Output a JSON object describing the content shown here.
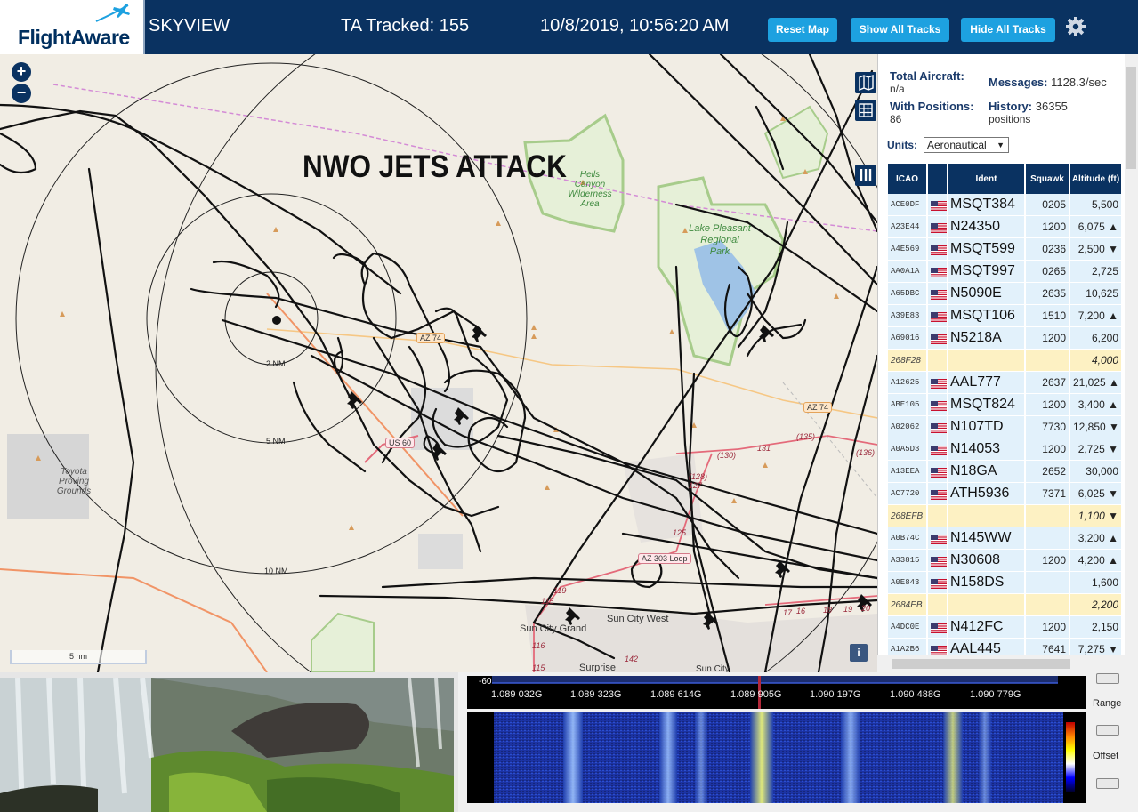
{
  "header": {
    "logo_text": "FlightAware",
    "site_name": "SKYVIEW",
    "tracked": "TA Tracked: 155",
    "datetime": "10/8/2019, 10:56:20 AM",
    "buttons": {
      "reset": "Reset Map",
      "show_all": "Show All Tracks",
      "hide_all": "Hide All Tracks"
    }
  },
  "map": {
    "overlay_title": "NWO JETS ATTACK",
    "zoom_in": "+",
    "zoom_out": "−",
    "range_labels": [
      "2 NM",
      "5 NM",
      "10 NM"
    ],
    "park_labels": [
      "Hells Canyon",
      "Wilderness",
      "Area",
      "Lake Pleasant",
      "Regional",
      "Park",
      "Toyota",
      "Proving",
      "Grounds"
    ],
    "city_labels": [
      "Sun City West",
      "Sun City Grand",
      "Surprise",
      "Sun City"
    ],
    "road_badges": [
      "US 60",
      "AZ 74",
      "AZ 74",
      "AZ 303 Loop"
    ],
    "route_numbers": [
      "(135)",
      "131",
      "(130)",
      "(128)",
      "127",
      "125",
      "(136)",
      "119",
      "115",
      "116",
      "115",
      "142",
      "17",
      "16",
      "18",
      "19",
      "20"
    ],
    "scale": "5 nm",
    "info_button": "i"
  },
  "stats": {
    "total_aircraft_label": "Total Aircraft:",
    "total_aircraft_value": "n/a",
    "with_positions_label": "With Positions:",
    "with_positions_value": "86",
    "messages_label": "Messages:",
    "messages_value": "1128.3/sec",
    "history_label": "History:",
    "history_value": "36355",
    "history_unit": "positions"
  },
  "units": {
    "label": "Units:",
    "selected": "Aeronautical"
  },
  "table": {
    "headers": [
      "ICAO",
      "Ident",
      "Squawk",
      "Altitude (ft)"
    ],
    "rows": [
      {
        "icao": "ACE0DF",
        "flag": true,
        "ident": "MSQT384",
        "squawk": "0205",
        "alt": "5,500"
      },
      {
        "icao": "A23E44",
        "flag": true,
        "ident": "N24350",
        "squawk": "1200",
        "alt": "6,075 ▲"
      },
      {
        "icao": "A4E569",
        "flag": true,
        "ident": "MSQT599",
        "squawk": "0236",
        "alt": "2,500 ▼"
      },
      {
        "icao": "AA0A1A",
        "flag": true,
        "ident": "MSQT997",
        "squawk": "0265",
        "alt": "2,725"
      },
      {
        "icao": "A65DBC",
        "flag": true,
        "ident": "N5090E",
        "squawk": "2635",
        "alt": "10,625"
      },
      {
        "icao": "A39E83",
        "flag": true,
        "ident": "MSQT106",
        "squawk": "1510",
        "alt": "7,200 ▲"
      },
      {
        "icao": "A69016",
        "flag": true,
        "ident": "N5218A",
        "squawk": "1200",
        "alt": "6,200"
      },
      {
        "icao": "268F28",
        "flag": false,
        "ident": "",
        "squawk": "",
        "alt": "4,000"
      },
      {
        "icao": "A12625",
        "flag": true,
        "ident": "AAL777",
        "squawk": "2637",
        "alt": "21,025 ▲"
      },
      {
        "icao": "ABE105",
        "flag": true,
        "ident": "MSQT824",
        "squawk": "1200",
        "alt": "3,400 ▲"
      },
      {
        "icao": "A02062",
        "flag": true,
        "ident": "N107TD",
        "squawk": "7730",
        "alt": "12,850 ▼"
      },
      {
        "icao": "A0A5D3",
        "flag": true,
        "ident": "N14053",
        "squawk": "1200",
        "alt": "2,725 ▼"
      },
      {
        "icao": "A13EEA",
        "flag": true,
        "ident": "N18GA",
        "squawk": "2652",
        "alt": "30,000"
      },
      {
        "icao": "AC7720",
        "flag": true,
        "ident": "ATH5936",
        "squawk": "7371",
        "alt": "6,025 ▼"
      },
      {
        "icao": "268EFB",
        "flag": false,
        "ident": "",
        "squawk": "",
        "alt": "1,100 ▼"
      },
      {
        "icao": "A0B74C",
        "flag": true,
        "ident": "N145WW",
        "squawk": "",
        "alt": "3,200 ▲"
      },
      {
        "icao": "A33815",
        "flag": true,
        "ident": "N30608",
        "squawk": "1200",
        "alt": "4,200 ▲"
      },
      {
        "icao": "A0E843",
        "flag": true,
        "ident": "N158DS",
        "squawk": "",
        "alt": "1,600"
      },
      {
        "icao": "2684EB",
        "flag": false,
        "ident": "",
        "squawk": "",
        "alt": "2,200"
      },
      {
        "icao": "A4DC0E",
        "flag": true,
        "ident": "N412FC",
        "squawk": "1200",
        "alt": "2,150"
      },
      {
        "icao": "A1A2B6",
        "flag": true,
        "ident": "AAL445",
        "squawk": "7641",
        "alt": "7,275 ▼"
      }
    ]
  },
  "spectrum": {
    "level": "-60",
    "frequencies": [
      "1.089 032G",
      "1.089 323G",
      "1.089 614G",
      "1.089 905G",
      "1.090 197G",
      "1.090 488G",
      "1.090 779G"
    ],
    "controls": {
      "range": "Range",
      "offset": "Offset"
    }
  },
  "colors": {
    "header_bg": "#0a3261",
    "button_bg": "#1da1e0",
    "row_bg": "#e2f1fb",
    "noflag_row_bg": "#fdf1c3"
  }
}
